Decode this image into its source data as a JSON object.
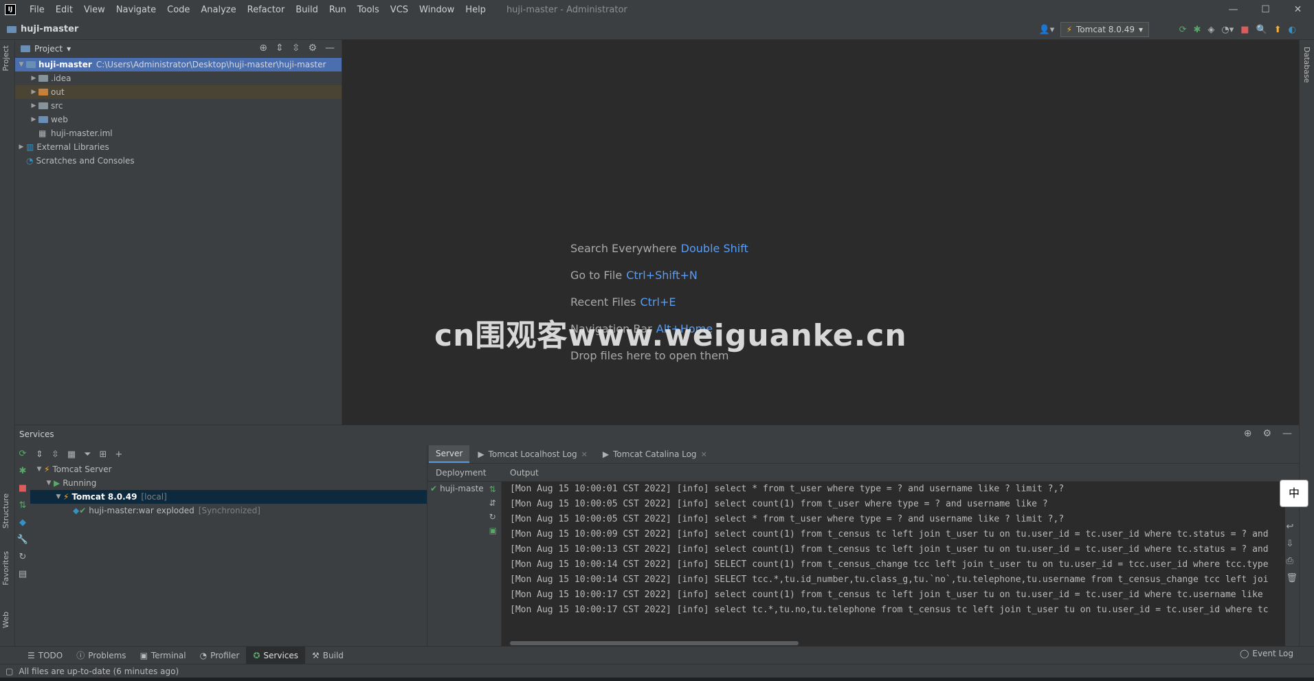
{
  "app": {
    "logo_text": "IJ",
    "menu": [
      "File",
      "Edit",
      "View",
      "Navigate",
      "Code",
      "Analyze",
      "Refactor",
      "Build",
      "Run",
      "Tools",
      "VCS",
      "Window",
      "Help"
    ],
    "window_title": "huji-master - Administrator",
    "window_controls": [
      "—",
      "☐",
      "✕"
    ]
  },
  "navbar": {
    "project_name": "huji-master",
    "run_config": "Tomcat 8.0.49"
  },
  "left_stripe": {
    "project": "Project",
    "structure": "Structure",
    "favorites": "Favorites",
    "web": "Web"
  },
  "right_stripe": {
    "database": "Database"
  },
  "project_panel": {
    "title": "Project",
    "tree": [
      {
        "label": "huji-master",
        "path": "C:\\Users\\Administrator\\Desktop\\huji-master\\huji-master"
      },
      {
        "label": ".idea"
      },
      {
        "label": "out"
      },
      {
        "label": "src"
      },
      {
        "label": "web"
      },
      {
        "label": "huji-master.iml"
      },
      {
        "label": "External Libraries"
      },
      {
        "label": "Scratches and Consoles"
      }
    ]
  },
  "editor": {
    "hints": [
      {
        "label": "Search Everywhere",
        "key": "Double Shift"
      },
      {
        "label": "Go to File",
        "key": "Ctrl+Shift+N"
      },
      {
        "label": "Recent Files",
        "key": "Ctrl+E"
      },
      {
        "label": "Navigation Bar",
        "key": "Alt+Home"
      },
      {
        "label": "Drop files here to open them",
        "key": ""
      }
    ],
    "watermark": "cn围观客www.weiguanke.cn"
  },
  "services": {
    "title": "Services",
    "tree": [
      {
        "label": "Tomcat Server",
        "note": ""
      },
      {
        "label": "Running",
        "note": ""
      },
      {
        "label": "Tomcat 8.0.49",
        "note": "[local]"
      },
      {
        "label": "huji-master:war exploded",
        "note": "[Synchronized]"
      }
    ],
    "tabs": [
      {
        "label": "Server"
      },
      {
        "label": "Tomcat Localhost Log"
      },
      {
        "label": "Tomcat Catalina Log"
      }
    ],
    "deployment_header": "Deployment",
    "output_header": "Output",
    "deployment_item": "huji-maste",
    "output_lines": [
      "[Mon Aug 15 10:00:01 CST 2022] [info] select * from t_user where type = ? and username like ? limit ?,?",
      "[Mon Aug 15 10:00:05 CST 2022] [info] select count(1) from t_user where type = ? and username like ?",
      "[Mon Aug 15 10:00:05 CST 2022] [info] select * from t_user where type = ? and username like ? limit ?,?",
      "[Mon Aug 15 10:00:09 CST 2022] [info] select count(1) from t_census tc left join t_user tu on  tu.user_id = tc.user_id where tc.status = ? and",
      "[Mon Aug 15 10:00:13 CST 2022] [info] select count(1) from t_census tc left join t_user tu on  tu.user_id = tc.user_id where tc.status = ? and",
      "[Mon Aug 15 10:00:14 CST 2022] [info] SELECT count(1) from t_census_change tcc left join t_user tu on tu.user_id = tcc.user_id where tcc.type",
      "[Mon Aug 15 10:00:14 CST 2022] [info] SELECT tcc.*,tu.id_number,tu.class_g,tu.`no`,tu.telephone,tu.username from t_census_change tcc left joi",
      "[Mon Aug 15 10:00:17 CST 2022] [info] select count(1) from t_census tc left join t_user tu on  tu.user_id = tc.user_id where tc.username like",
      "[Mon Aug 15 10:00:17 CST 2022] [info] select tc.*,tu.no,tu.telephone from t_census tc left join t_user tu on  tu.user_id = tc.user_id where tc"
    ]
  },
  "tool_windows": [
    "TODO",
    "Problems",
    "Terminal",
    "Profiler",
    "Services",
    "Build"
  ],
  "event_log": "Event Log",
  "status": "All files are up-to-date (6 minutes ago)",
  "ime": {
    "label": "中"
  },
  "colors": {
    "accent": "#4b6eaf",
    "link": "#589df6",
    "background": "#2b2b2b",
    "panel": "#3c3f41"
  }
}
